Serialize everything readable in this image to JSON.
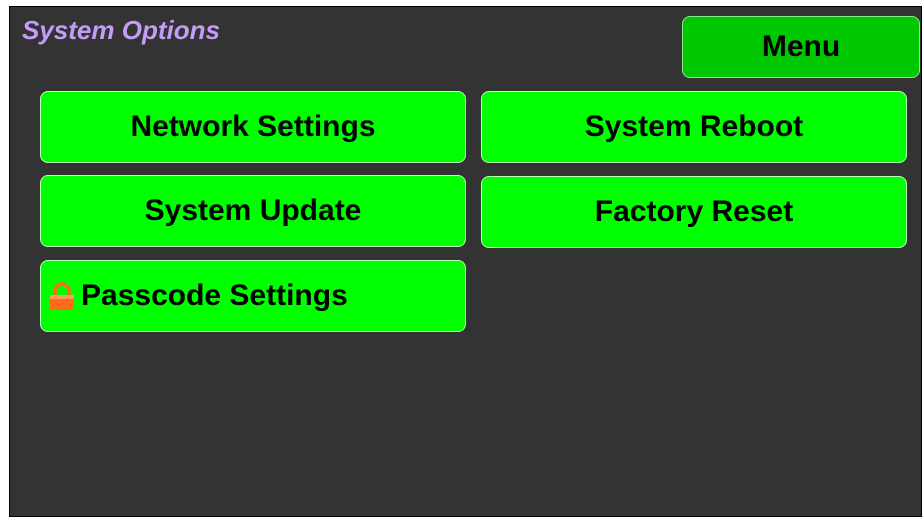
{
  "header": {
    "title": "System Options",
    "menu_label": "Menu"
  },
  "options": [
    {
      "label": "Network Settings"
    },
    {
      "label": "System Reboot"
    },
    {
      "label": "System Update"
    },
    {
      "label": "Factory Reset"
    },
    {
      "label": "Passcode Settings",
      "icon": "lock-icon"
    }
  ],
  "colors": {
    "background": "#333333",
    "title": "#c49cf7",
    "button": "#00ff00",
    "menu_button": "#00c800",
    "lock": "#ff6a1a"
  }
}
